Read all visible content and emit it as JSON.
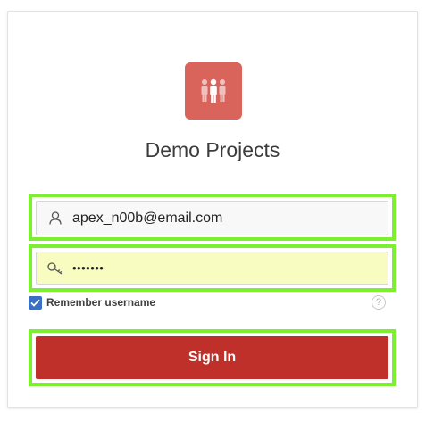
{
  "app": {
    "title": "Demo Projects",
    "logo_icon": "people-group-icon"
  },
  "login": {
    "username_value": "apex_n00b@email.com",
    "username_icon": "user-icon",
    "password_value": "•••••••",
    "password_icon": "key-icon",
    "remember_label": "Remember username",
    "remember_checked": true,
    "help_icon": "question-circle-icon",
    "help_glyph": "?",
    "signin_label": "Sign In"
  },
  "colors": {
    "logo_bg": "#d9645c",
    "accent_highlight": "#7cf030",
    "signin_bg": "#c0302a",
    "password_bg": "#f8fcc0",
    "username_bg": "#f8f8f8",
    "checkbox_bg": "#3a6fc4"
  }
}
